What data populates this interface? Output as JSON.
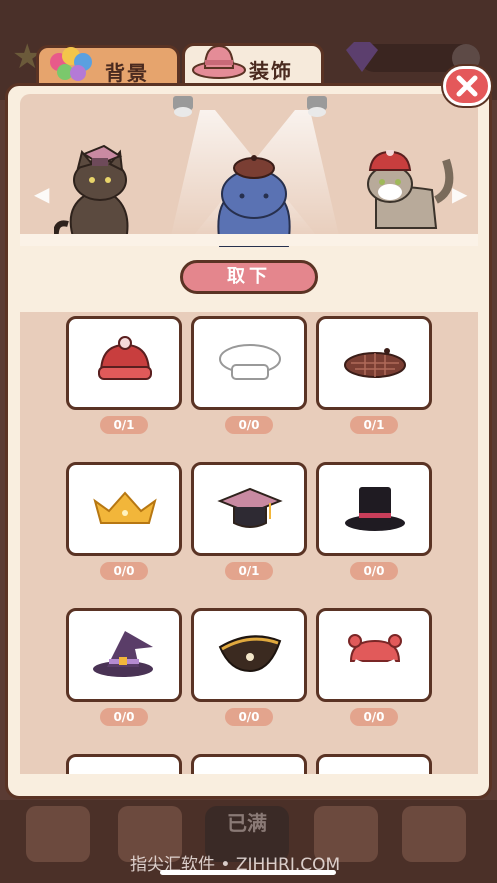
{
  "tabs": [
    {
      "label": "背景"
    },
    {
      "label": "装饰"
    }
  ],
  "actions": {
    "remove_label": "取下"
  },
  "items": [
    {
      "icon": "red-beanie-hat-icon",
      "count": "0/1"
    },
    {
      "icon": "chef-hat-icon",
      "count": "0/0"
    },
    {
      "icon": "plaid-beret-icon",
      "count": "0/1"
    },
    {
      "icon": "gold-crown-icon",
      "count": "0/0"
    },
    {
      "icon": "graduation-cap-icon",
      "count": "0/1"
    },
    {
      "icon": "black-top-hat-icon",
      "count": "0/0"
    },
    {
      "icon": "witch-hat-icon",
      "count": "0/0"
    },
    {
      "icon": "pirate-hat-icon",
      "count": "0/0"
    },
    {
      "icon": "red-ear-cap-icon",
      "count": "0/0"
    }
  ],
  "bottom_bar": {
    "full_label": "已满"
  },
  "watermark": "指尖汇软件 • ZJHHRJ.COM",
  "colors": {
    "accent": "#e4868d",
    "border": "#5a3324",
    "panel": "#f9eedf"
  }
}
